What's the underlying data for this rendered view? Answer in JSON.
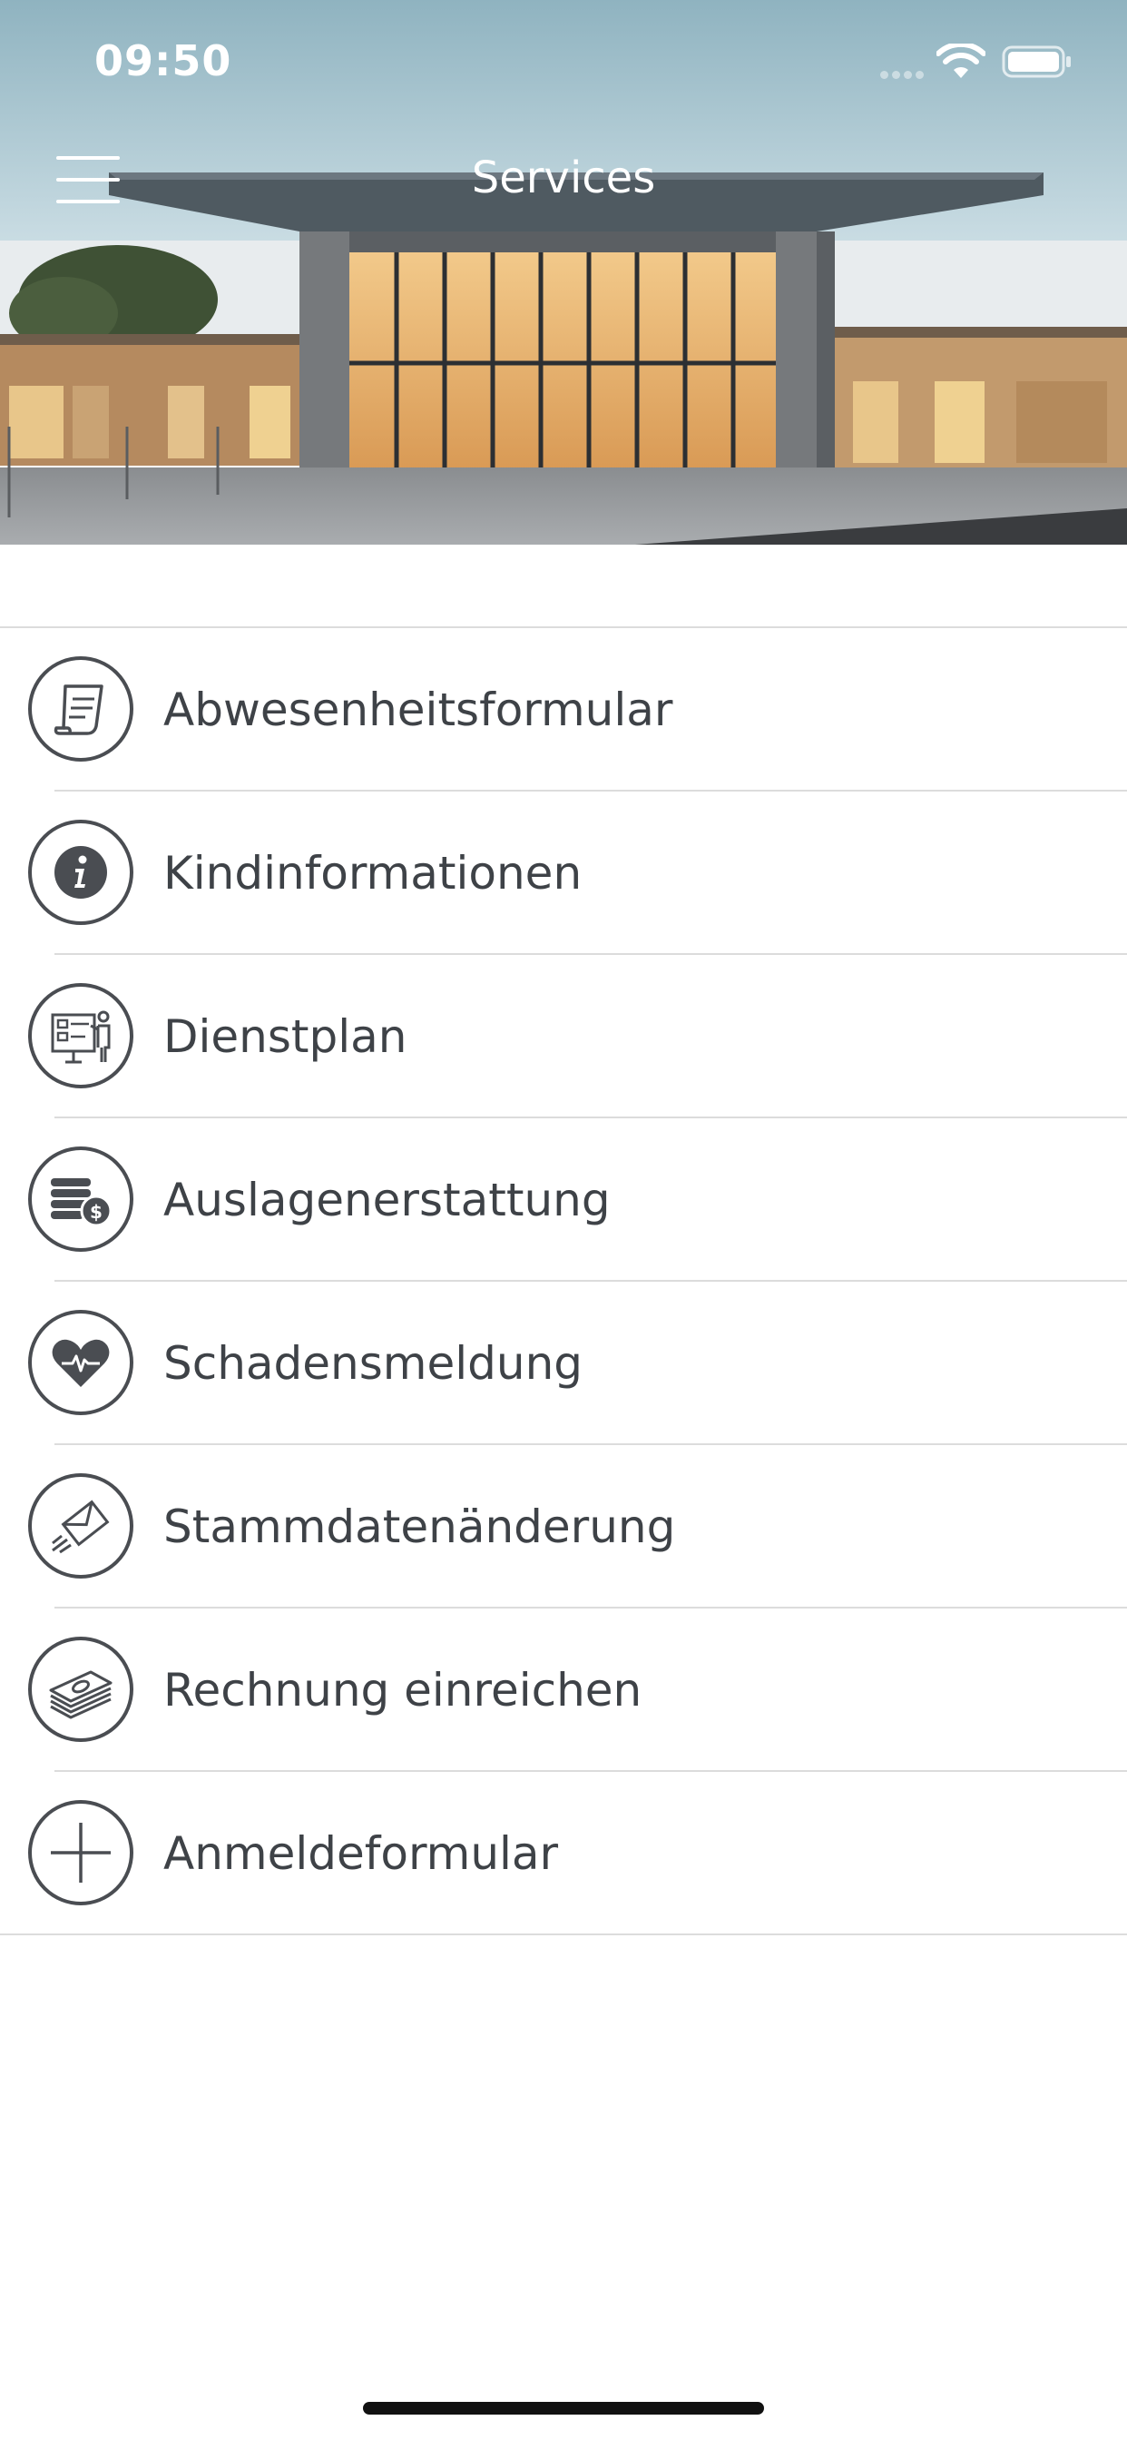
{
  "status_bar": {
    "time": "09:50"
  },
  "header": {
    "title": "Services"
  },
  "services": [
    {
      "label": "Abwesenheitsformular",
      "icon": "form-document-icon"
    },
    {
      "label": "Kindinformationen",
      "icon": "info-icon"
    },
    {
      "label": "Dienstplan",
      "icon": "schedule-board-icon"
    },
    {
      "label": "Auslagenerstattung",
      "icon": "coins-dollar-icon"
    },
    {
      "label": "Schadensmeldung",
      "icon": "heart-pulse-icon"
    },
    {
      "label": "Stammdatenänderung",
      "icon": "send-envelope-icon"
    },
    {
      "label": "Rechnung einreichen",
      "icon": "money-stack-icon"
    },
    {
      "label": "Anmeldeformular",
      "icon": "plus-icon"
    }
  ],
  "colors": {
    "icon": "#4a4d52",
    "separator": "#dcdcdc",
    "text": "#3e4247"
  }
}
